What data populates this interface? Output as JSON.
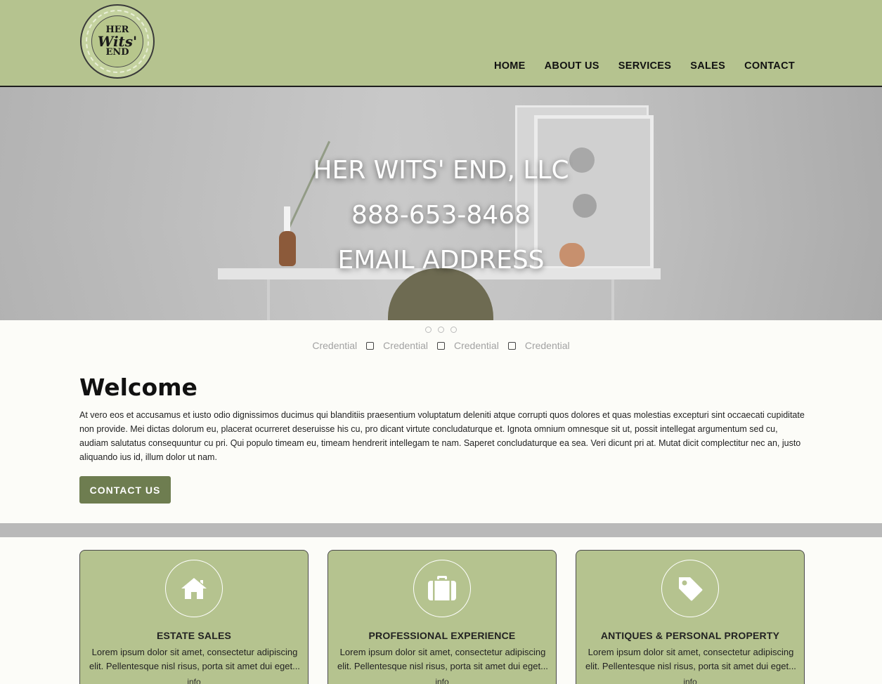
{
  "logo": {
    "line1": "HER",
    "line2": "Wits'",
    "line3": "END"
  },
  "nav": {
    "items": [
      {
        "label": "HOME"
      },
      {
        "label": "ABOUT US"
      },
      {
        "label": "SERVICES"
      },
      {
        "label": "SALES"
      },
      {
        "label": "CONTACT"
      }
    ]
  },
  "hero": {
    "company": "HER WITS' END, LLC",
    "phone": "888-653-8468",
    "email": "EMAIL ADDRESS"
  },
  "slider": {
    "dot_count": 3
  },
  "credentials": [
    "Credential",
    "Credential",
    "Credential",
    "Credential"
  ],
  "welcome": {
    "title": "Welcome",
    "body": "At vero eos et accusamus et iusto odio dignissimos ducimus qui blanditiis praesentium voluptatum deleniti atque corrupti quos dolores et quas molestias excepturi sint occaecati cupiditate non provide. Mei dictas dolorum eu, placerat ocurreret deseruisse his cu, pro dicant virtute concludaturque et. Ignota omnium omnesque sit ut, possit intellegat argumentum sed cu, audiam salutatus consequuntur cu pri. Qui populo timeam eu, timeam hendrerit intellegam te nam. Saperet concludaturque ea sea. Veri dicunt pri at. Mutat dicit complectitur nec an, justo aliquando ius id, illum dolor ut nam.",
    "button": "CONTACT US"
  },
  "cards": [
    {
      "icon": "home-icon",
      "title": "ESTATE SALES",
      "body": "Lorem ipsum dolor sit amet, consectetur adipiscing elit. Pellentesque nisl risus, porta sit amet dui eget...",
      "more": "info"
    },
    {
      "icon": "briefcase-icon",
      "title": "PROFESSIONAL EXPERIENCE",
      "body": "Lorem ipsum dolor sit amet, consectetur adipiscing elit. Pellentesque nisl risus, porta sit amet dui eget...",
      "more": "info"
    },
    {
      "icon": "tag-icon",
      "title": "ANTIQUES & PERSONAL PROPERTY",
      "body": "Lorem ipsum dolor sit amet, consectetur adipiscing elit. Pellentesque nisl risus, porta sit amet dui eget...",
      "more": "info"
    }
  ],
  "colors": {
    "header_bg": "#b5c38f",
    "button_bg": "#6e7d50",
    "divider": "#b9b9b9",
    "page_bg": "#fcfcf8"
  }
}
